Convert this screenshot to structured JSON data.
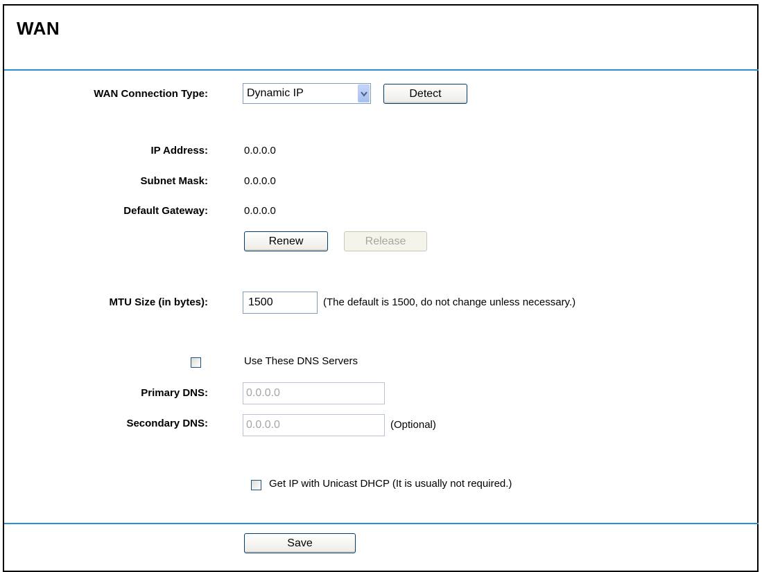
{
  "page": {
    "title": "WAN"
  },
  "wan_type": {
    "label": "WAN Connection Type:",
    "selected": "Dynamic IP",
    "detect_label": "Detect"
  },
  "status": {
    "ip_label": "IP Address:",
    "ip_value": "0.0.0.0",
    "subnet_label": "Subnet Mask:",
    "subnet_value": "0.0.0.0",
    "gateway_label": "Default Gateway:",
    "gateway_value": "0.0.0.0",
    "renew_label": "Renew",
    "release_label": "Release"
  },
  "mtu": {
    "label": "MTU Size (in bytes):",
    "value": "1500",
    "hint": "(The default is 1500, do not change unless necessary.)"
  },
  "dns": {
    "use_label": "Use These DNS Servers",
    "use_checked": false,
    "primary_label": "Primary DNS:",
    "primary_value": "0.0.0.0",
    "secondary_label": "Secondary DNS:",
    "secondary_value": "0.0.0.0",
    "secondary_hint": "(Optional)"
  },
  "unicast": {
    "label": "Get IP with Unicast DHCP (It is usually not required.)",
    "checked": false
  },
  "footer": {
    "save_label": "Save"
  },
  "colors": {
    "rule": "#2a8fd0",
    "button_border": "#003c74"
  }
}
